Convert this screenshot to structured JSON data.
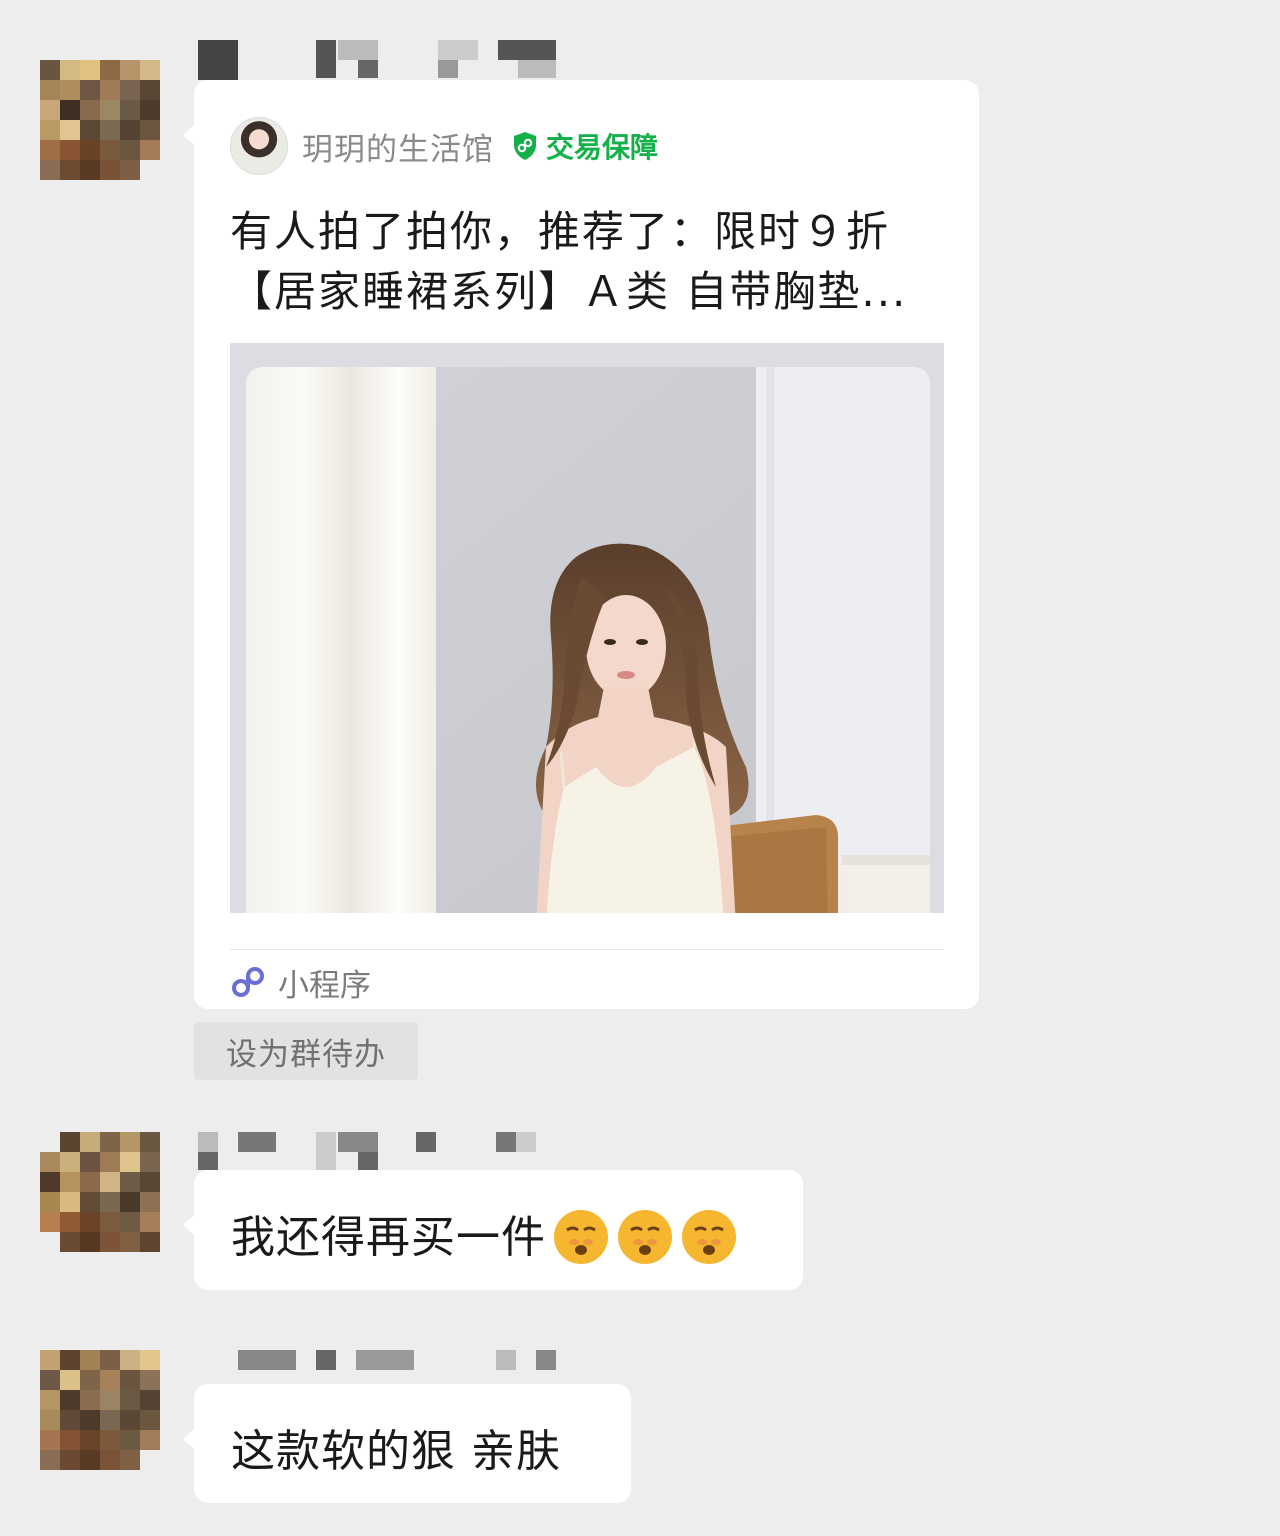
{
  "card": {
    "shop_name": "玥玥的生活馆",
    "guarantee_label": "交易保障",
    "title_line1": "有人拍了拍你，推荐了：限时９折",
    "title_line2": "【居家睡裙系列】Ａ类 自带胸垫...",
    "footer_label": "小程序"
  },
  "todo": {
    "label": "设为群待办"
  },
  "messages": [
    {
      "text": "我还得再买一件",
      "emoji": "face-with-nose-steam-icon"
    },
    {
      "text": "这款软的狠 亲肤"
    }
  ],
  "colors": {
    "background": "#ededed",
    "bubble": "#ffffff",
    "guarantee_green": "#14b14a",
    "miniprogram_purple": "#6a6fd6"
  }
}
